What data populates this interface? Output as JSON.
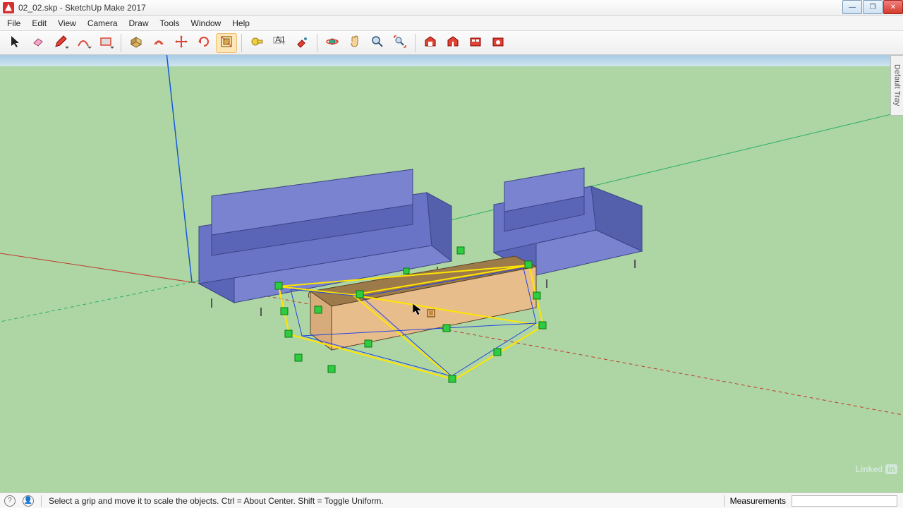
{
  "window": {
    "title": "02_02.skp - SketchUp Make 2017",
    "controls": {
      "min": "—",
      "max": "❐",
      "close": "✕"
    }
  },
  "menu": {
    "items": [
      "File",
      "Edit",
      "View",
      "Camera",
      "Draw",
      "Tools",
      "Window",
      "Help"
    ]
  },
  "toolbar": {
    "groups": [
      [
        {
          "name": "select-tool",
          "icon": "cursor",
          "dd": false,
          "active": false
        },
        {
          "name": "eraser-tool",
          "icon": "eraser",
          "dd": false,
          "active": false
        },
        {
          "name": "line-tool",
          "icon": "pencil",
          "dd": true,
          "active": false
        },
        {
          "name": "arc-tool",
          "icon": "arc",
          "dd": true,
          "active": false
        },
        {
          "name": "shapes-tool",
          "icon": "rect",
          "dd": true,
          "active": false
        }
      ],
      [
        {
          "name": "pushpull-tool",
          "icon": "pushpull",
          "dd": false,
          "active": false
        },
        {
          "name": "offset-tool",
          "icon": "offset",
          "dd": false,
          "active": false
        },
        {
          "name": "move-tool",
          "icon": "move",
          "dd": false,
          "active": false
        },
        {
          "name": "rotate-tool",
          "icon": "rotate",
          "dd": false,
          "active": false
        },
        {
          "name": "scale-tool",
          "icon": "scale",
          "dd": false,
          "active": true
        }
      ],
      [
        {
          "name": "tape-tool",
          "icon": "tape",
          "dd": false,
          "active": false
        },
        {
          "name": "text-tool",
          "icon": "text",
          "dd": false,
          "active": false
        },
        {
          "name": "paint-tool",
          "icon": "paint",
          "dd": false,
          "active": false
        }
      ],
      [
        {
          "name": "orbit-tool",
          "icon": "orbit",
          "dd": false,
          "active": false
        },
        {
          "name": "pan-tool",
          "icon": "pan",
          "dd": false,
          "active": false
        },
        {
          "name": "zoom-tool",
          "icon": "zoom",
          "dd": false,
          "active": false
        },
        {
          "name": "zoom-extents-tool",
          "icon": "zoomext",
          "dd": false,
          "active": false
        }
      ],
      [
        {
          "name": "warehouse-tool",
          "icon": "wh1",
          "dd": false,
          "active": false
        },
        {
          "name": "warehouse-share-tool",
          "icon": "wh2",
          "dd": false,
          "active": false
        },
        {
          "name": "extension-tool",
          "icon": "ext1",
          "dd": false,
          "active": false
        },
        {
          "name": "extension-mgr-tool",
          "icon": "ext2",
          "dd": false,
          "active": false
        }
      ]
    ]
  },
  "tray": {
    "label": "Default Tray"
  },
  "status": {
    "hint": "Select a grip and move it to scale the objects. Ctrl = About Center. Shift = Toggle Uniform.",
    "measurements_label": "Measurements"
  },
  "branding": {
    "linkedin": "Linked",
    "linkedin_suffix": "in"
  },
  "scene": {
    "axes": {
      "origin": [
        272,
        322
      ],
      "blue_up": [
        232,
        -40
      ],
      "red_far": [
        1280,
        510
      ],
      "red_near": [
        0,
        398
      ],
      "green_far": [
        1280,
        158
      ],
      "green_near": [
        0,
        456
      ]
    },
    "sofa": {
      "color": "#6a74c7",
      "edge": "#3b4486"
    },
    "armchair": {
      "color": "#6a74c7",
      "edge": "#3b4486"
    },
    "table": {
      "top": "#9c7a4a",
      "side": "#e8bd8c",
      "edge": "#5a4326"
    },
    "selection": {
      "line": "#ffe600"
    }
  }
}
